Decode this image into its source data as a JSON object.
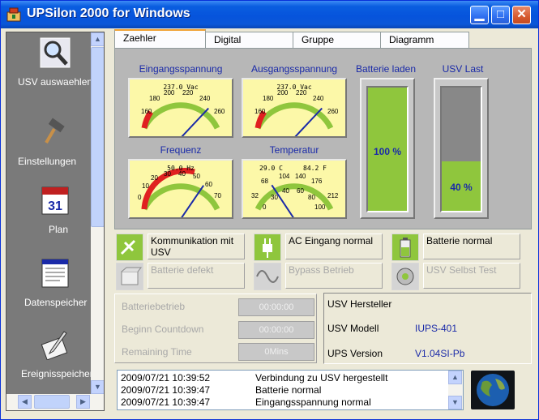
{
  "window": {
    "title": "UPSilon 2000 for Windows"
  },
  "sidebar": {
    "items": [
      {
        "label": "USV auswaehlen",
        "icon": "magnifier-icon"
      },
      {
        "label": "Einstellungen",
        "icon": "hammer-icon"
      },
      {
        "label": "Plan",
        "icon": "calendar-icon"
      },
      {
        "label": "Datenspeicher",
        "icon": "data-log-icon"
      },
      {
        "label": "Ereignisspeicher",
        "icon": "quill-icon"
      }
    ],
    "calendar_day": "31"
  },
  "tabs": [
    {
      "label": "Zaehler",
      "active": true
    },
    {
      "label": "Digital",
      "active": false
    },
    {
      "label": "Gruppe",
      "active": false
    },
    {
      "label": "Diagramm",
      "active": false
    }
  ],
  "gauges": {
    "input_voltage": {
      "label": "Eingangsspannung",
      "readout": "237.0 Vac",
      "ticks": [
        "160",
        "180",
        "200",
        "220",
        "240",
        "260"
      ],
      "value": 237.0,
      "min": 160,
      "max": 260
    },
    "output_voltage": {
      "label": "Ausgangsspannung",
      "readout": "237.0 Vac",
      "ticks": [
        "160",
        "180",
        "200",
        "220",
        "240",
        "260"
      ],
      "value": 237.0,
      "min": 160,
      "max": 260
    },
    "frequency": {
      "label": "Frequenz",
      "readout": "50.0 Hz",
      "ticks": [
        "0",
        "10",
        "20",
        "30",
        "40",
        "50",
        "60",
        "70"
      ],
      "value": 50.0,
      "min": 0,
      "max": 70
    },
    "temperature": {
      "label": "Temperatur",
      "readout_c": "29.0 C",
      "readout_f": "84.2 F",
      "ticks_f": [
        "32",
        "68",
        "104",
        "140",
        "176",
        "212"
      ],
      "ticks_c": [
        "0",
        "30",
        "40",
        "60",
        "80",
        "100"
      ],
      "value": 29.0,
      "min": 0,
      "max": 100
    }
  },
  "bars": {
    "battery_charge": {
      "label": "Batterie laden",
      "text": "100 %",
      "percent": 100
    },
    "ups_load": {
      "label": "USV Last",
      "text": "40 %",
      "percent": 40
    }
  },
  "status": {
    "communication": {
      "text": "Kommunikation mit USV",
      "active": true
    },
    "ac_input": {
      "text": "AC Eingang normal",
      "active": true
    },
    "battery_normal": {
      "text": "Batterie normal",
      "active": true
    },
    "battery_defect": {
      "text": "Batterie defekt",
      "active": false
    },
    "bypass": {
      "text": "Bypass Betrieb",
      "active": false
    },
    "self_test": {
      "text": "USV Selbst Test",
      "active": false
    }
  },
  "timers": [
    {
      "label": "Batteriebetrieb",
      "value": "00:00:00"
    },
    {
      "label": "Beginn Countdown",
      "value": "00:00:00"
    },
    {
      "label": "Remaining Time",
      "value": "0Mins"
    }
  ],
  "info": {
    "manufacturer_label": "USV Hersteller",
    "manufacturer_value": "",
    "model_label": "USV Modell",
    "model_value": "IUPS-401",
    "version_label": "UPS Version",
    "version_value": "V1.04SI-Pb"
  },
  "log": [
    {
      "time": "2009/07/21 10:39:52",
      "message": "Verbindung zu USV hergestellt"
    },
    {
      "time": "2009/07/21 10:39:47",
      "message": "Batterie normal"
    },
    {
      "time": "2009/07/21 10:39:47",
      "message": "Eingangsspannung normal"
    }
  ],
  "colors": {
    "accent_green": "#8fc63d",
    "label_blue": "#1a2aa8",
    "gauge_face": "#fcf8a8",
    "title_blue": "#0654dc"
  }
}
